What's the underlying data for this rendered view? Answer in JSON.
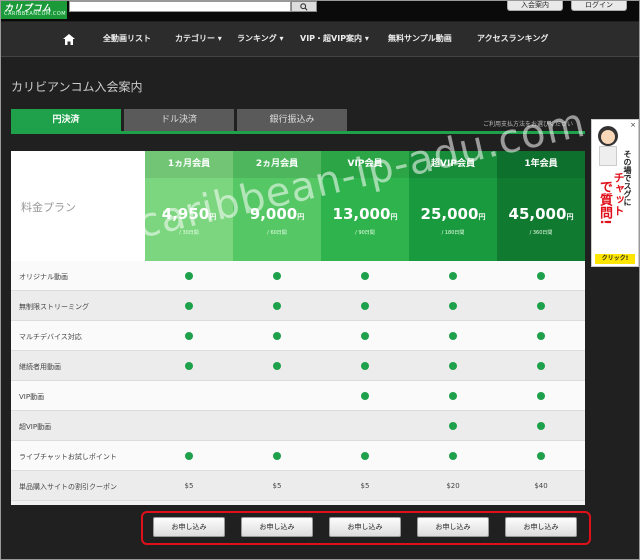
{
  "topbar": {
    "logo_main": "カリブコム",
    "logo_sub": "CARIBBEANCOM.COM",
    "search_icon": "search-icon",
    "join_label": "入会案内",
    "login_label": "ログイン"
  },
  "nav": {
    "home_icon": "home-icon",
    "items": [
      "全動画リスト",
      "カテゴリー ▾",
      "ランキング ▾",
      "VIP・超VIP案内 ▾",
      "無料サンプル動画",
      "アクセスランキング"
    ]
  },
  "page": {
    "title": "カリビアンコム入会案内"
  },
  "tabs": {
    "items": [
      "円決済",
      "ドル決済",
      "銀行振込み"
    ],
    "note": "ご利用支払方法をお選びください"
  },
  "table": {
    "corner_label": "料金プラン",
    "plans": [
      {
        "name": "1ヵ月会員",
        "price": "4,950",
        "unit": "円",
        "duration": "/ 30日間",
        "color": "#7bd67f"
      },
      {
        "name": "2ヵ月会員",
        "price": "9,000",
        "unit": "円",
        "duration": "/ 60日間",
        "color": "#55c765"
      },
      {
        "name": "VIP会員",
        "price": "13,000",
        "unit": "円",
        "duration": "/ 90日間",
        "color": "#2fb44d"
      },
      {
        "name": "超VIP会員",
        "price": "25,000",
        "unit": "円",
        "duration": "/ 180日間",
        "color": "#1a9a3e"
      },
      {
        "name": "1年会員",
        "price": "45,000",
        "unit": "円",
        "duration": "/ 360日間",
        "color": "#0f7a30"
      }
    ],
    "features": [
      {
        "label": "オリジナル動画",
        "cells": [
          true,
          true,
          true,
          true,
          true
        ]
      },
      {
        "label": "無制限ストリーミング",
        "cells": [
          true,
          true,
          true,
          true,
          true
        ]
      },
      {
        "label": "マルチデバイス対応",
        "cells": [
          true,
          true,
          true,
          true,
          true
        ]
      },
      {
        "label": "継続者用動画",
        "cells": [
          true,
          true,
          true,
          true,
          true
        ]
      },
      {
        "label": "VIP動画",
        "cells": [
          false,
          false,
          true,
          true,
          true
        ]
      },
      {
        "label": "超VIP動画",
        "cells": [
          false,
          false,
          false,
          true,
          true
        ]
      },
      {
        "label": "ライブチャットお試しポイント",
        "cells": [
          true,
          true,
          true,
          true,
          true
        ]
      },
      {
        "label": "単品購入サイトの割引クーポン",
        "cells": [
          "$5",
          "$5",
          "$5",
          "$20",
          "$40"
        ]
      }
    ]
  },
  "apply": {
    "label": "お申し込み"
  },
  "ad": {
    "close": "×",
    "line1": "その場でスグに",
    "line2": "チャット",
    "line3": "で質問!",
    "click": "クリック!"
  },
  "watermark": "/caribbean-ip-adu.com"
}
